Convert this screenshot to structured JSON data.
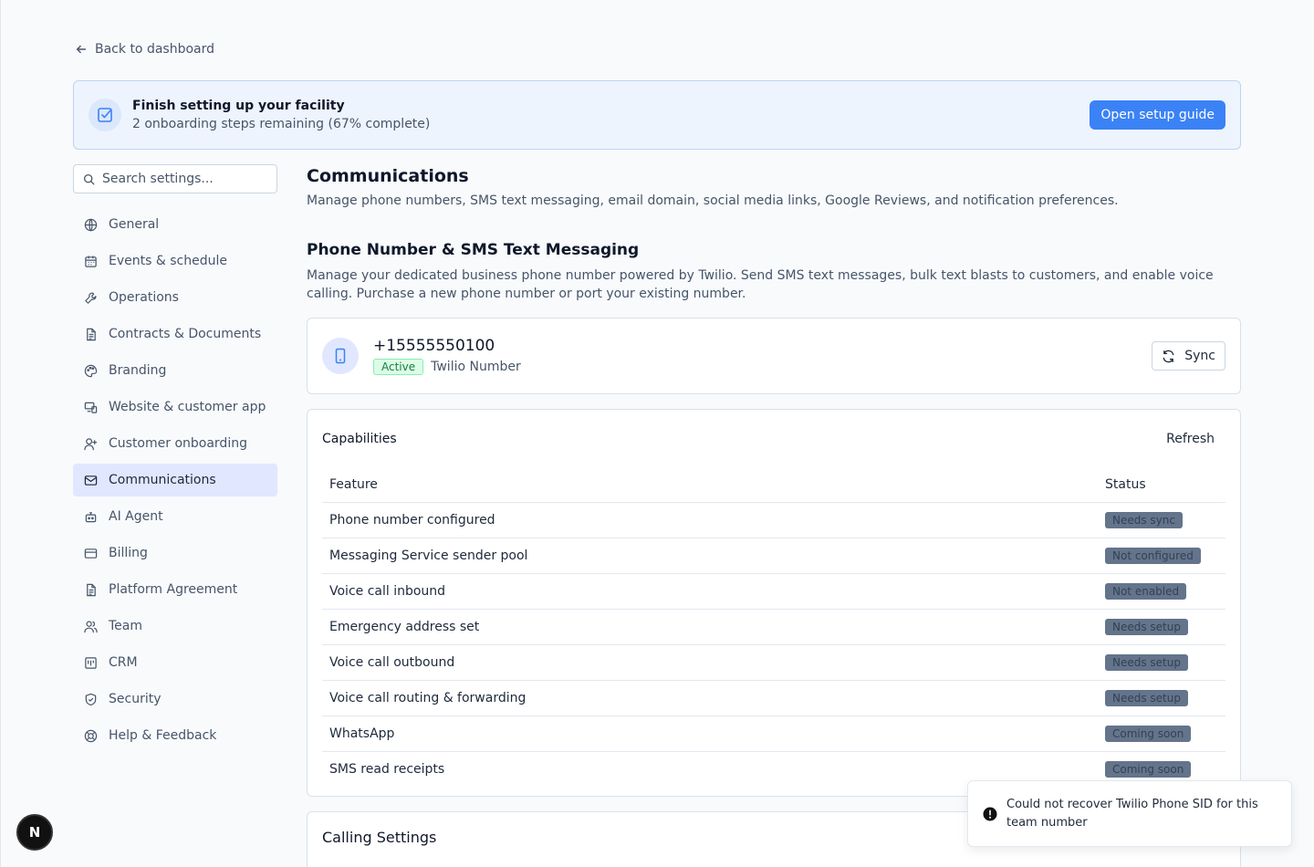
{
  "back_link": "Back to dashboard",
  "setup": {
    "title": "Finish setting up your facility",
    "progress": "2 onboarding steps remaining (67% complete)",
    "button": "Open setup guide"
  },
  "search": {
    "placeholder": "Search settings..."
  },
  "sidebar": {
    "items": [
      {
        "label": "General",
        "icon": "globe-icon"
      },
      {
        "label": "Events & schedule",
        "icon": "calendar-icon"
      },
      {
        "label": "Operations",
        "icon": "wrench-icon"
      },
      {
        "label": "Contracts & Documents",
        "icon": "document-icon"
      },
      {
        "label": "Branding",
        "icon": "palette-icon"
      },
      {
        "label": "Website & customer app",
        "icon": "devices-icon"
      },
      {
        "label": "Customer onboarding",
        "icon": "user-plus-icon"
      },
      {
        "label": "Communications",
        "icon": "mail-icon",
        "active": true
      },
      {
        "label": "AI Agent",
        "icon": "bot-icon"
      },
      {
        "label": "Billing",
        "icon": "credit-card-icon"
      },
      {
        "label": "Platform Agreement",
        "icon": "document-icon"
      },
      {
        "label": "Team",
        "icon": "users-icon"
      },
      {
        "label": "CRM",
        "icon": "crm-icon"
      },
      {
        "label": "Security",
        "icon": "shield-icon"
      },
      {
        "label": "Help & Feedback",
        "icon": "lifebuoy-icon"
      }
    ]
  },
  "main": {
    "title": "Communications",
    "subtitle": "Manage phone numbers, SMS text messaging, email domain, social media links, Google Reviews, and notification preferences.",
    "section_title": "Phone Number & SMS Text Messaging",
    "section_desc": "Manage your dedicated business phone number powered by Twilio. Send SMS text messages, bulk text blasts to customers, and enable voice calling. Purchase a new phone number or port your existing number.",
    "phone": {
      "number": "+15555550100",
      "status": "Active",
      "type": "Twilio Number",
      "sync_label": "Sync"
    },
    "capabilities": {
      "title": "Capabilities",
      "refresh_label": "Refresh",
      "columns": [
        "Feature",
        "Status"
      ],
      "rows": [
        {
          "feature": "Phone number configured",
          "status": "Needs sync"
        },
        {
          "feature": "Messaging Service sender pool",
          "status": "Not configured"
        },
        {
          "feature": "Voice call inbound",
          "status": "Not enabled"
        },
        {
          "feature": "Emergency address set",
          "status": "Needs setup"
        },
        {
          "feature": "Voice call outbound",
          "status": "Needs setup"
        },
        {
          "feature": "Voice call routing & forwarding",
          "status": "Needs setup"
        },
        {
          "feature": "WhatsApp",
          "status": "Coming soon"
        },
        {
          "feature": "SMS read receipts",
          "status": "Coming soon"
        }
      ]
    },
    "calling": {
      "title": "Calling Settings"
    }
  },
  "toast": {
    "message": "Could not recover Twilio Phone SID for this team number"
  },
  "fab": {
    "label": "N"
  },
  "colors": {
    "accent": "#3b82f6",
    "active_nav": "#e0e7ff",
    "status_pill": "#64748b"
  }
}
